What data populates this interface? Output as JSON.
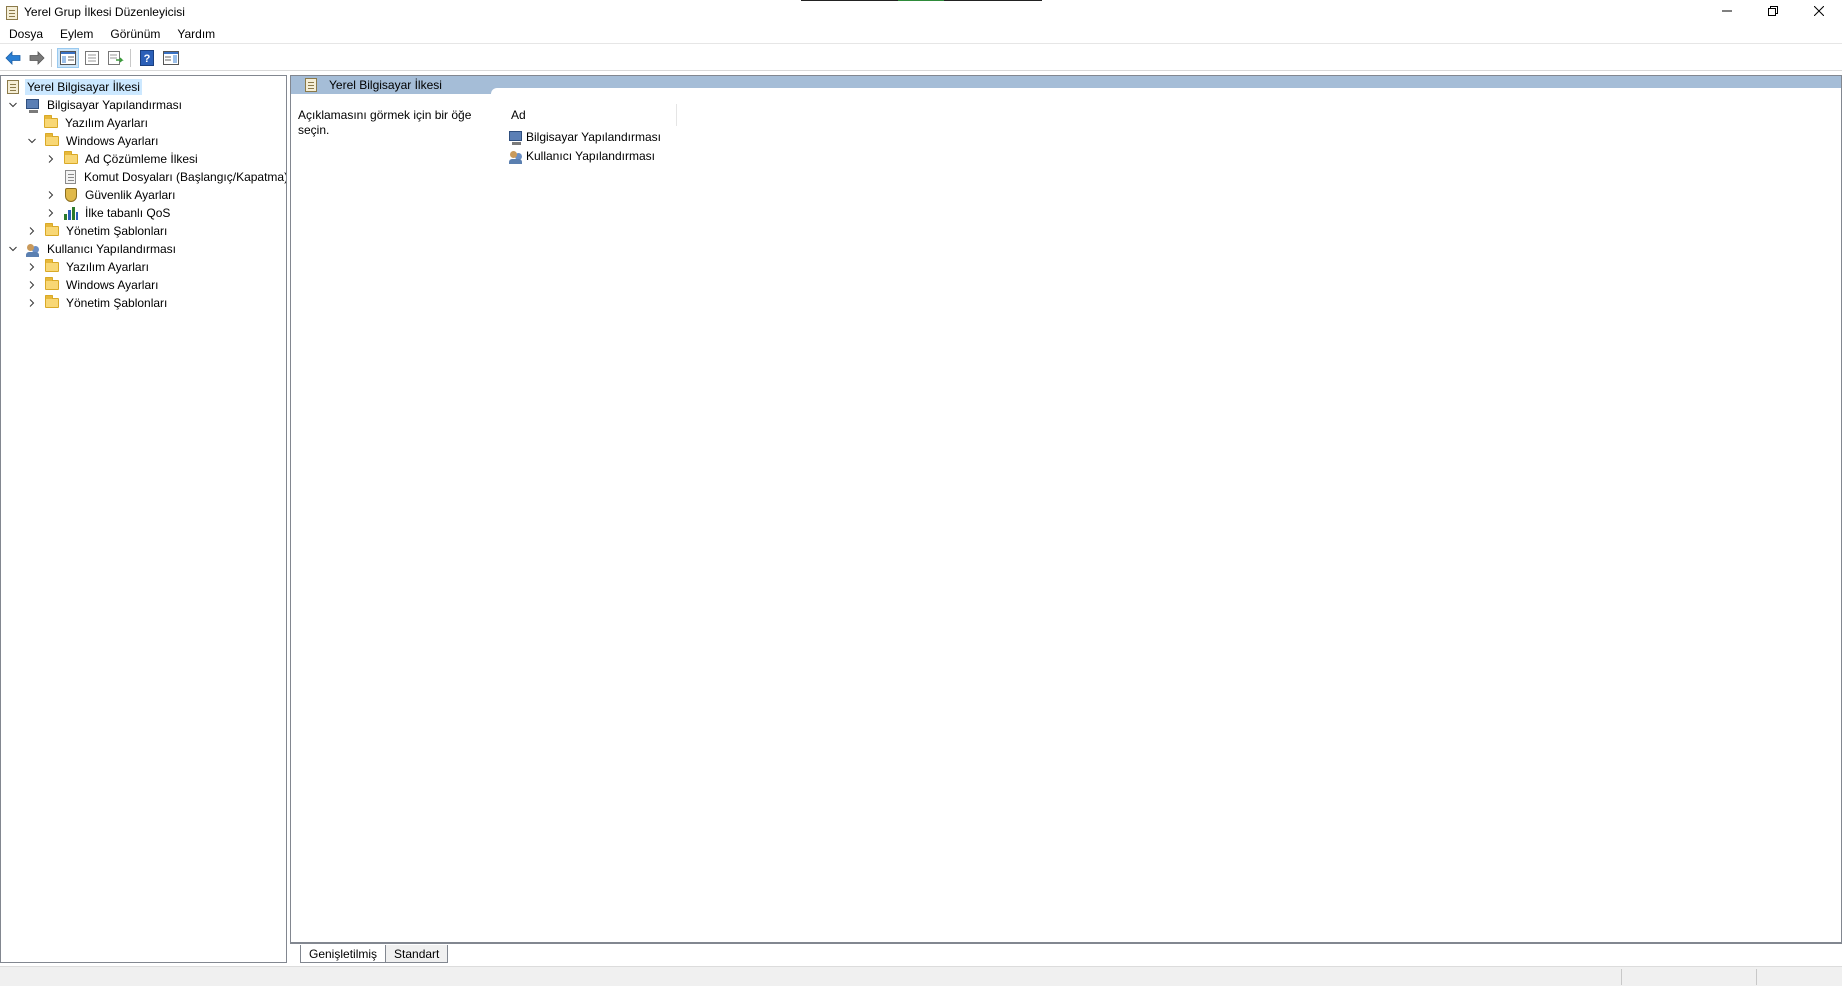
{
  "window": {
    "title": "Yerel Grup İlkesi Düzenleyicisi",
    "controls": [
      "minimize",
      "restore",
      "close"
    ]
  },
  "menu": {
    "items": [
      "Dosya",
      "Eylem",
      "Görünüm",
      "Yardım"
    ]
  },
  "toolbar": {
    "buttons": [
      "back-arrow-icon",
      "forward-arrow-icon",
      "show-tree-icon",
      "properties-icon",
      "export-list-icon",
      "help-icon",
      "show-pane-icon"
    ]
  },
  "tree": {
    "items": [
      {
        "label": "Yerel Bilgisayar İlkesi",
        "icon": "policy-icon",
        "level": 0,
        "expander": "none",
        "selected": true
      },
      {
        "label": "Bilgisayar Yapılandırması",
        "icon": "computer-config-icon",
        "level": 0,
        "expander": "expanded"
      },
      {
        "label": "Yazılım Ayarları",
        "icon": "folder-icon",
        "level": 1,
        "expander": "none"
      },
      {
        "label": "Windows Ayarları",
        "icon": "folder-icon",
        "level": 1,
        "expander": "expanded"
      },
      {
        "label": "Ad Çözümleme İlkesi",
        "icon": "folder-icon",
        "level": 2,
        "expander": "collapsed"
      },
      {
        "label": "Komut Dosyaları (Başlangıç/Kapatma)",
        "icon": "script-icon",
        "level": 2,
        "expander": "none"
      },
      {
        "label": "Güvenlik Ayarları",
        "icon": "security-icon",
        "level": 2,
        "expander": "collapsed"
      },
      {
        "label": "İlke tabanlı QoS",
        "icon": "qos-chart-icon",
        "level": 2,
        "expander": "collapsed"
      },
      {
        "label": "Yönetim Şablonları",
        "icon": "folder-icon",
        "level": 1,
        "expander": "collapsed"
      },
      {
        "label": "Kullanıcı Yapılandırması",
        "icon": "user-config-icon",
        "level": 0,
        "expander": "expanded"
      },
      {
        "label": "Yazılım Ayarları",
        "icon": "folder-icon",
        "level": 1,
        "expander": "collapsed"
      },
      {
        "label": "Windows Ayarları",
        "icon": "folder-icon",
        "level": 1,
        "expander": "collapsed"
      },
      {
        "label": "Yönetim Şablonları",
        "icon": "folder-icon",
        "level": 1,
        "expander": "collapsed"
      }
    ]
  },
  "right": {
    "header": "Yerel Bilgisayar İlkesi",
    "description": "Açıklamasını görmek için bir öğe seçin.",
    "column_header": "Ad",
    "items": [
      {
        "label": "Bilgisayar Yapılandırması",
        "icon": "computer-config-icon"
      },
      {
        "label": "Kullanıcı Yapılandırması",
        "icon": "user-config-icon"
      }
    ]
  },
  "tabs": {
    "items": [
      "Genişletilmiş",
      "Standart"
    ],
    "active": "Genişletilmiş"
  },
  "colors": {
    "header_band": "#a5bdd7",
    "selection": "#cce8ff",
    "folder": "#f8d775"
  }
}
